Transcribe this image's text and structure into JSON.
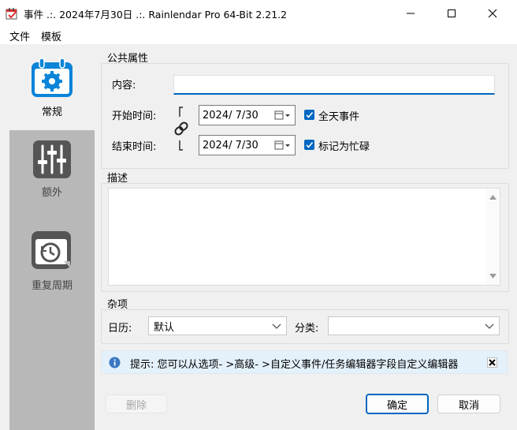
{
  "window": {
    "title": "事件 .:. 2024年7月30日 .:. Rainlendar Pro 64-Bit 2.21.2"
  },
  "menu": {
    "items": [
      "文件",
      "模板"
    ]
  },
  "sidebar": {
    "items": [
      {
        "label": "常规",
        "icon": "calendar-gear-icon",
        "active": true
      },
      {
        "label": "额外",
        "icon": "sliders-icon",
        "active": false
      },
      {
        "label": "重复周期",
        "icon": "recurrence-clock-icon",
        "active": false
      }
    ]
  },
  "public_props": {
    "title": "公共属性",
    "content_label": "内容:",
    "content_value": "",
    "start_label": "开始时间:",
    "start_date": "2024/  7/30",
    "end_label": "结束时间:",
    "end_date": "2024/  7/30",
    "allday_label": "全天事件",
    "allday_checked": true,
    "busy_label": "标记为忙碌",
    "busy_checked": true
  },
  "description": {
    "title": "描述",
    "value": ""
  },
  "misc": {
    "title": "杂项",
    "calendar_label": "日历:",
    "calendar_value": "默认",
    "category_label": "分类:",
    "category_value": ""
  },
  "hint": {
    "text": "提示: 您可以从选项- >高级- >自定义事件/任务编辑器字段自定义编辑器"
  },
  "buttons": {
    "delete": "删除",
    "ok": "确定",
    "cancel": "取消"
  },
  "colors": {
    "accent": "#0067c0",
    "sidebar_bg": "#b8b8b8",
    "hint_bg": "#e4f1fb"
  }
}
